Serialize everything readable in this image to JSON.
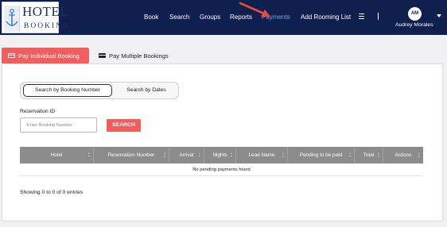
{
  "brand": {
    "line1": "HOTEL",
    "line2": "BOOKING",
    "icon": "anchor-icon"
  },
  "nav": {
    "items": [
      {
        "label": "Book"
      },
      {
        "label": "Search"
      },
      {
        "label": "Groups"
      },
      {
        "label": "Reports"
      },
      {
        "label": "Payments",
        "active": true
      },
      {
        "label": "Add Rooming List"
      }
    ],
    "menu_icon": "hamburger-icon"
  },
  "user": {
    "initials": "AM",
    "name": "Audrey Morales"
  },
  "tabs": [
    {
      "label": "Pay Individual Booking",
      "icon": "credit-card-icon",
      "active": true
    },
    {
      "label": "Pay Multiple Bookings",
      "icon": "credit-card-icon",
      "active": false
    }
  ],
  "search_mode": {
    "options": [
      "Search by Booking Number",
      "Search by Dates"
    ],
    "selected": "Search by Booking Number"
  },
  "reservation": {
    "label": "Reservation ID",
    "placeholder": "Enter Booking Number",
    "value": ""
  },
  "search_button": "SEARCH",
  "table": {
    "columns": [
      "Hotel",
      "Reservation Number",
      "Arrival",
      "Nights",
      "Lead Name",
      "Pending to be paid",
      "Total",
      "Actions"
    ],
    "empty_message": "No pending payments found",
    "entries_info": "Showing 0 to 0 of 0 entries"
  },
  "colors": {
    "navbar": "#0f1f4e",
    "accent": "#f05e5e",
    "table_header": "#8c8c8c",
    "annotation_arrow": "#e74c3c"
  }
}
